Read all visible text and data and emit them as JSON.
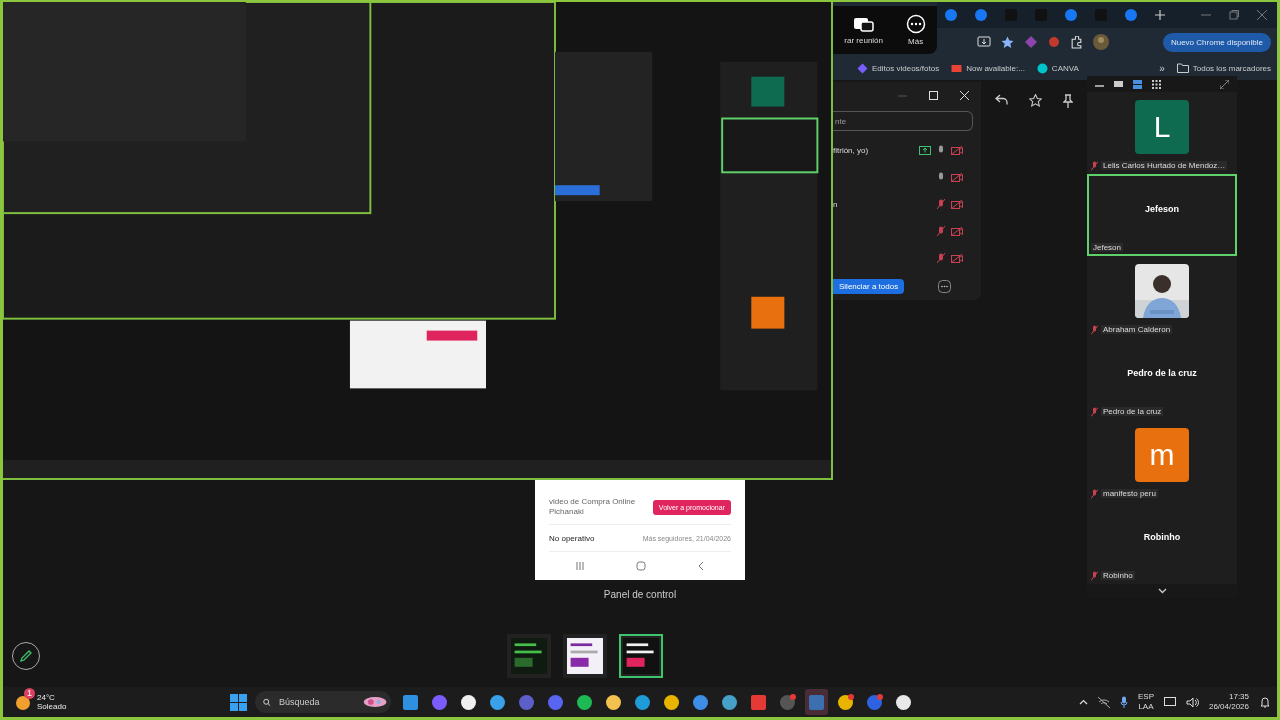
{
  "meeting_toolbar": {
    "items": [
      {
        "kind": "stop",
        "label": "rar reunión"
      },
      {
        "kind": "more",
        "label": "Más"
      }
    ]
  },
  "browser": {
    "tabs": [
      {
        "kind": "round"
      },
      {
        "kind": "round"
      },
      {
        "kind": "square"
      },
      {
        "kind": "square"
      },
      {
        "kind": "round"
      },
      {
        "kind": "square"
      },
      {
        "kind": "round"
      }
    ],
    "update_button": "Nuevo Chrome disponible",
    "bookmarks": [
      {
        "kind": "diamond",
        "label": "Editos videos/fotos"
      },
      {
        "kind": "mail",
        "label": "Now available:..."
      },
      {
        "kind": "circle",
        "label": "CANVA"
      }
    ],
    "bookmarks_overflow": "»",
    "all_bookmarks": "Todos los marcadores"
  },
  "participants_panel": {
    "search_placeholder": "nte",
    "rows": [
      {
        "name": "fitrión, yo)",
        "sharing": true,
        "muted": false
      },
      {
        "sharing": false,
        "muted": false
      },
      {
        "name": "n",
        "sharing": false,
        "muted": true
      },
      {
        "sharing": false,
        "muted": true
      },
      {
        "sharing": false,
        "muted": true
      }
    ],
    "mute_all_button": "Silenciar a todos"
  },
  "gallery": {
    "tiles": [
      {
        "kind": "avatar",
        "letter": "L",
        "color": "#0f6b4f",
        "name": "Lelis Carlos Hurtado de Mendoz…",
        "muted": true,
        "selected": false
      },
      {
        "kind": "title",
        "title": "Jefeson",
        "name": "Jefeson",
        "muted": false,
        "selected": true
      },
      {
        "name": "Abraham Calderon",
        "muted": true,
        "selected": false
      },
      {
        "kind": "title",
        "title": "Pedro de la cruz",
        "name": "Pedro de la cruz",
        "muted": true,
        "selected": false
      },
      {
        "kind": "avatar",
        "letter": "m",
        "color": "#e8700f",
        "name": "manifesto peru",
        "muted": true,
        "selected": false
      },
      {
        "kind": "title",
        "title": "Robinho",
        "name": "Robinho",
        "muted": true,
        "selected": false
      }
    ]
  },
  "phone": {
    "title": "video de Compra Online Pichanaki",
    "button": "Volver a promocionar",
    "status": "No operativo",
    "detail": "Más seguidores, 21/04/2026",
    "caption": "Panel de control"
  },
  "thumbnails": [
    {
      "selected": false
    },
    {
      "selected": false
    },
    {
      "selected": true
    }
  ],
  "taskbar": {
    "weather": {
      "temp": "24°C",
      "condition": "Soleado",
      "badge": "1"
    },
    "search_placeholder": "Búsqueda",
    "apps": [
      {
        "kind": "windows",
        "active": false,
        "alert": false
      },
      {
        "kind": "copilot",
        "active": false,
        "alert": false
      },
      {
        "kind": "store",
        "active": false,
        "alert": false
      },
      {
        "kind": "mail",
        "active": false,
        "alert": false
      },
      {
        "kind": "teams",
        "active": false,
        "alert": false
      },
      {
        "kind": "chat",
        "active": false,
        "alert": false
      },
      {
        "kind": "music",
        "active": false,
        "alert": false
      },
      {
        "kind": "folder",
        "active": false,
        "alert": false
      },
      {
        "kind": "wave",
        "active": false,
        "alert": false
      },
      {
        "kind": "browser",
        "active": false,
        "alert": false
      },
      {
        "kind": "photos",
        "active": false,
        "alert": false
      },
      {
        "kind": "globe",
        "active": false,
        "alert": false
      },
      {
        "kind": "remote",
        "active": false,
        "alert": false
      },
      {
        "kind": "record",
        "active": false,
        "alert": true
      },
      {
        "kind": "calculator",
        "active": true,
        "alert": false
      },
      {
        "kind": "browser",
        "active": false,
        "alert": true
      },
      {
        "kind": "video",
        "active": false,
        "alert": true
      },
      {
        "kind": "cup",
        "active": false,
        "alert": false
      }
    ],
    "language": "ESP",
    "layout": "LAA",
    "time": "17:35",
    "date": "26/04/2026"
  }
}
